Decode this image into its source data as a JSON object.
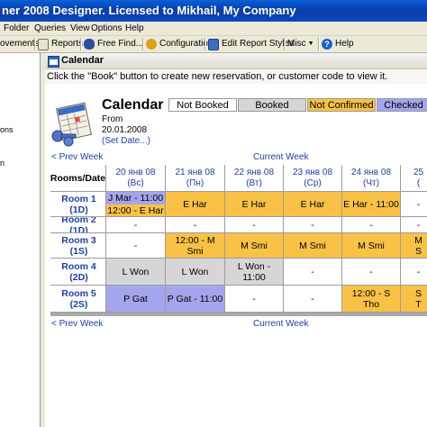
{
  "window": {
    "title": "ner 2008 Designer. Licensed to Mikhail, My Company"
  },
  "menu": [
    "Folder",
    "Queries",
    "View",
    "Options",
    "Help"
  ],
  "toolbar": {
    "items": [
      "ovements",
      "Reports",
      "Free Find...",
      "Configuration",
      "Edit Report Styles",
      "Misc",
      "Help"
    ]
  },
  "left_pane": {
    "items": [
      "ons",
      "n"
    ]
  },
  "colors": {
    "booked": "#d6d6d6",
    "not_confirmed": "#f9c246",
    "checked": "#a5a5ee",
    "free": "#ffffff",
    "link": "#1c3fa8"
  },
  "calendar": {
    "header_title": "Calendar",
    "hint": "Click the \"Book\" button to create new reservation, or customer code to view it.",
    "title": "Calendar",
    "from_label": "From",
    "from_date": "20.01.2008",
    "set_date": "(Set Date...)",
    "legend": [
      "Not Booked",
      "Booked",
      "Not Confirmed",
      "Checked"
    ],
    "prev_week": "< Prev Week",
    "current_week": "Current Week",
    "corner": "Rooms/Date",
    "days": [
      "20 янв 08\n(Вс)",
      "21 янв 08\n(Пн)",
      "22 янв 08\n(Вт)",
      "23 янв 08\n(Ср)",
      "24 янв 08\n(Чт)",
      "25\n("
    ],
    "rooms": [
      {
        "name": "Room 1 (1D)",
        "cells": [
          {
            "text": "J Mar - 11:00\n12:00 - E Har",
            "status": "split"
          },
          {
            "text": "E Har",
            "status": "not_confirmed"
          },
          {
            "text": "E Har",
            "status": "not_confirmed"
          },
          {
            "text": "E Har",
            "status": "not_confirmed"
          },
          {
            "text": "E Har - 11:00",
            "status": "not_confirmed"
          },
          {
            "text": "-",
            "status": "free"
          }
        ]
      },
      {
        "name": "Room 2 (1D)",
        "cells": [
          {
            "text": "-",
            "status": "free"
          },
          {
            "text": "-",
            "status": "free"
          },
          {
            "text": "-",
            "status": "free"
          },
          {
            "text": "-",
            "status": "free"
          },
          {
            "text": "-",
            "status": "free"
          },
          {
            "text": "-",
            "status": "free"
          }
        ]
      },
      {
        "name": "Room 3 (1S)",
        "cells": [
          {
            "text": "-",
            "status": "free"
          },
          {
            "text": "12:00 - M\nSmi",
            "status": "not_confirmed"
          },
          {
            "text": "M Smi",
            "status": "not_confirmed"
          },
          {
            "text": "M Smi",
            "status": "not_confirmed"
          },
          {
            "text": "M Smi",
            "status": "not_confirmed"
          },
          {
            "text": "M\nS",
            "status": "not_confirmed"
          }
        ]
      },
      {
        "name": "Room 4 (2D)",
        "cells": [
          {
            "text": "L Won",
            "status": "booked"
          },
          {
            "text": "L Won",
            "status": "booked"
          },
          {
            "text": "L Won -\n11:00",
            "status": "booked"
          },
          {
            "text": "-",
            "status": "free"
          },
          {
            "text": "-",
            "status": "free"
          },
          {
            "text": "-",
            "status": "free"
          }
        ]
      },
      {
        "name": "Room 5 (2S)",
        "cells": [
          {
            "text": "P Gat",
            "status": "checked"
          },
          {
            "text": "P Gat - 11:00",
            "status": "checked"
          },
          {
            "text": "-",
            "status": "free"
          },
          {
            "text": "-",
            "status": "free"
          },
          {
            "text": "12:00 - S\nTho",
            "status": "not_confirmed"
          },
          {
            "text": "S\nT",
            "status": "not_confirmed"
          }
        ]
      }
    ]
  }
}
